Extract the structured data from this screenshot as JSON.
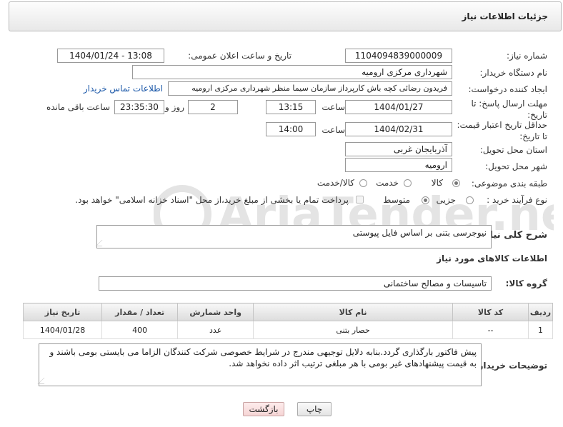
{
  "header": {
    "title": "جزئیات اطلاعات نیاز"
  },
  "form": {
    "need_number_label": "شماره نیاز:",
    "need_number": "1104094839000009",
    "announce_label": "تاریخ و ساعت اعلان عمومی:",
    "announce_value": "1404/01/24 - 13:08",
    "buyer_org_label": "نام دستگاه خریدار:",
    "buyer_org": "شهرداری مرکزی ارومیه",
    "creator_label": "ایجاد کننده درخواست:",
    "creator": "فریدون رضائی کچه باش کارپرداز سازمان سیما منظر شهرداری مرکزی ارومیه",
    "contact_link": "اطلاعات تماس خریدار",
    "deadline_label": "مهلت ارسال پاسخ: تا تاریخ:",
    "deadline_date": "1404/01/27",
    "time_label": "ساعت",
    "deadline_time": "13:15",
    "days_value": "2",
    "days_label": "روز و",
    "remaining_time": "23:35:30",
    "remaining_label": "ساعت باقی مانده",
    "min_validity_label": "حداقل تاریخ اعتبار قیمت: تا تاریخ:",
    "validity_date": "1404/02/31",
    "validity_time": "14:00",
    "province_label": "استان محل تحویل:",
    "province": "آذربایجان غربی",
    "city_label": "شهر محل تحویل:",
    "city": "ارومیه",
    "category_label": "طبقه بندی موضوعی:",
    "category_options": [
      "کالا",
      "خدمت",
      "کالا/خدمت"
    ],
    "category_selected": "کالا",
    "process_label": "نوع فرآیند خرید :",
    "process_options": [
      "جزیی",
      "متوسط"
    ],
    "process_selected": "متوسط",
    "payment_note": "پرداخت تمام یا بخشی از مبلغ خرید،از محل \"اسناد خزانه اسلامی\" خواهد بود."
  },
  "description": {
    "label": "شرح کلی نیاز:",
    "text": "نیوجرسی بتنی بر اساس فایل پیوستی"
  },
  "goods_section": {
    "title": "اطلاعات کالاهای مورد نیاز",
    "group_label": "گروه کالا:",
    "group_value": "تاسیسات و مصالح ساختمانی"
  },
  "table": {
    "headers": [
      "ردیف",
      "کد کالا",
      "نام کالا",
      "واحد شمارش",
      "تعداد / مقدار",
      "تاریخ نیاز"
    ],
    "rows": [
      [
        "1",
        "--",
        "حصار بتنی",
        "عدد",
        "400",
        "1404/01/28"
      ]
    ]
  },
  "buyer_notes": {
    "label": "توضیحات خریدار:",
    "text": "پیش فاکتور بارگذاری گردد.بنابه دلایل توجیهی مندرج در شرایط خصوصی شرکت کنندگان الزاما می بایستی بومی باشند و به قیمت پیشنهادهای غیر بومی با هر مبلغی ترتیب اثر داده نخواهد شد."
  },
  "buttons": {
    "print": "چاپ",
    "back": "بازگشت"
  },
  "watermark": {
    "text": "AriaTender.net"
  }
}
